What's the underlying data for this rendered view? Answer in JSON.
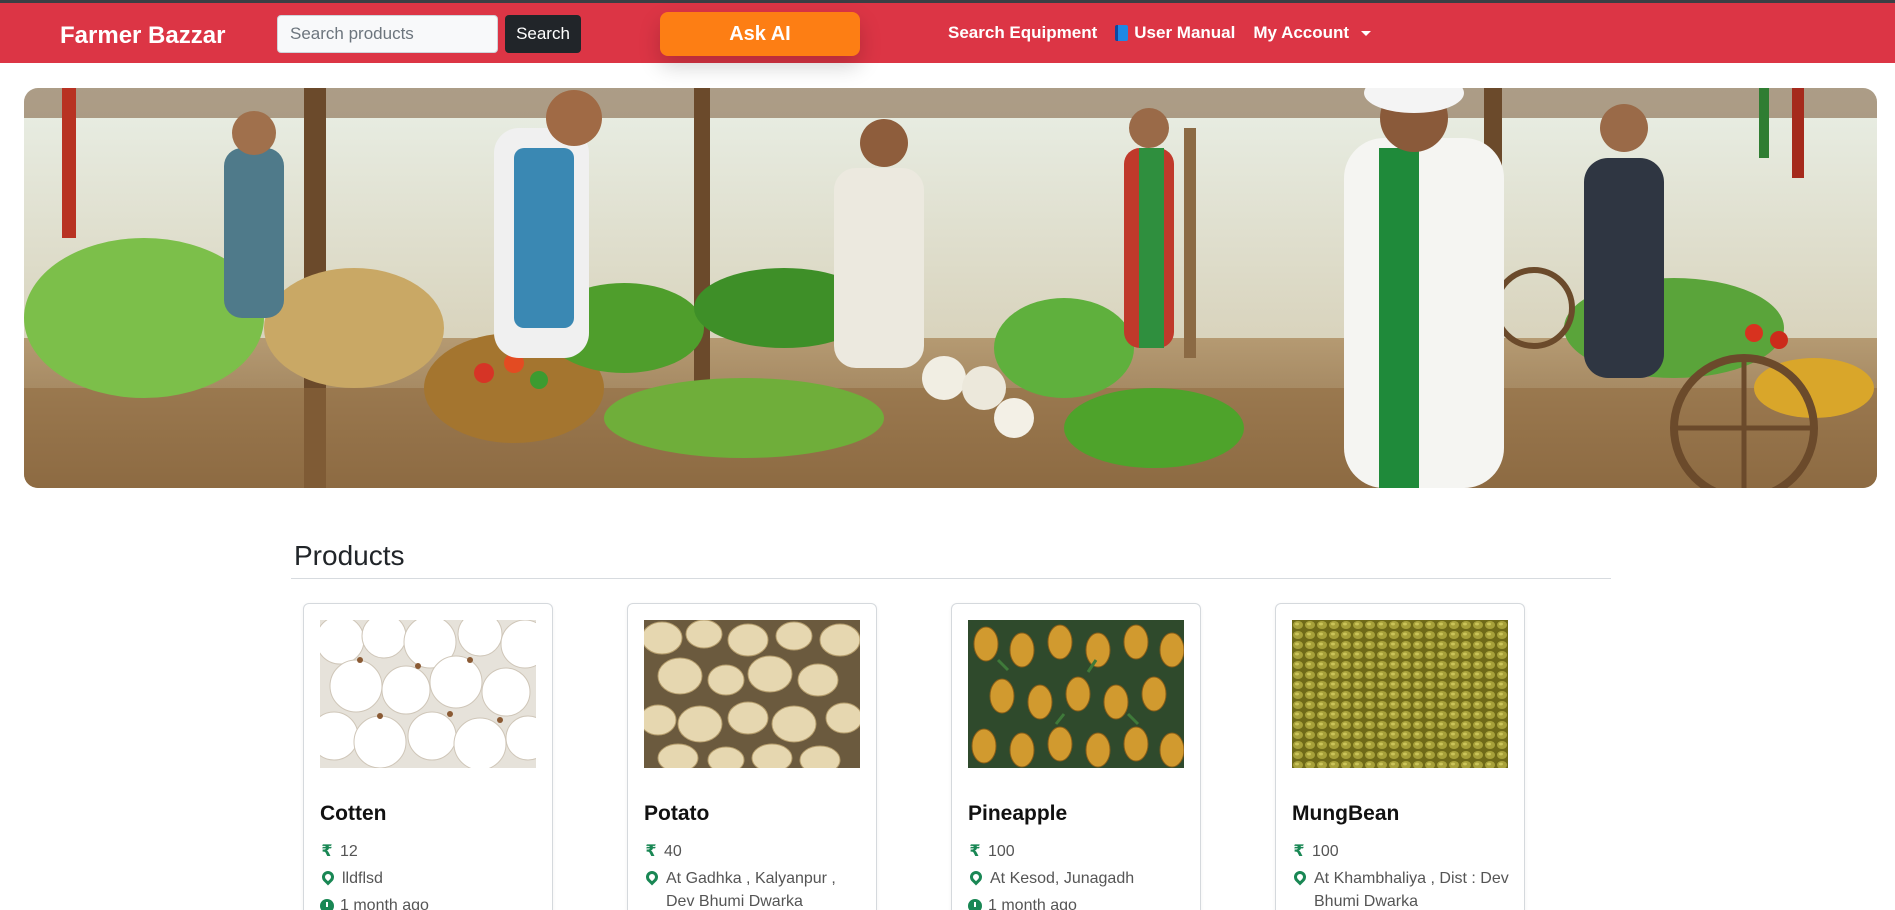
{
  "navbar": {
    "brand": "Farmer Bazzar",
    "search_placeholder": "Search products",
    "search_button": "Search",
    "ask_ai": "Ask AI",
    "links": {
      "search_equipment": "Search Equipment",
      "user_manual": "User Manual",
      "my_account": "My Account"
    }
  },
  "hero": {
    "icon": "farmers-market-banner"
  },
  "products": {
    "title": "Products",
    "items": [
      {
        "name": "Cotten",
        "price": "12",
        "location": "lldflsd",
        "time": "1 month ago",
        "image": "cotton"
      },
      {
        "name": "Potato",
        "price": "40",
        "location": "At Gadhka , Kalyanpur , Dev Bhumi Dwarka",
        "time": "",
        "image": "potato"
      },
      {
        "name": "Pineapple",
        "price": "100",
        "location": "At Kesod, Junagadh",
        "time": "1 month ago",
        "image": "pineapple"
      },
      {
        "name": "MungBean",
        "price": "100",
        "location": "At Khambhaliya , Dist : Dev Bhumi Dwarka",
        "time": "",
        "image": "mungbean"
      }
    ],
    "currency_symbol": "₹"
  },
  "colors": {
    "navbar": "#dc3545",
    "ask_ai": "#fd7e14",
    "icon_green": "#198754"
  }
}
